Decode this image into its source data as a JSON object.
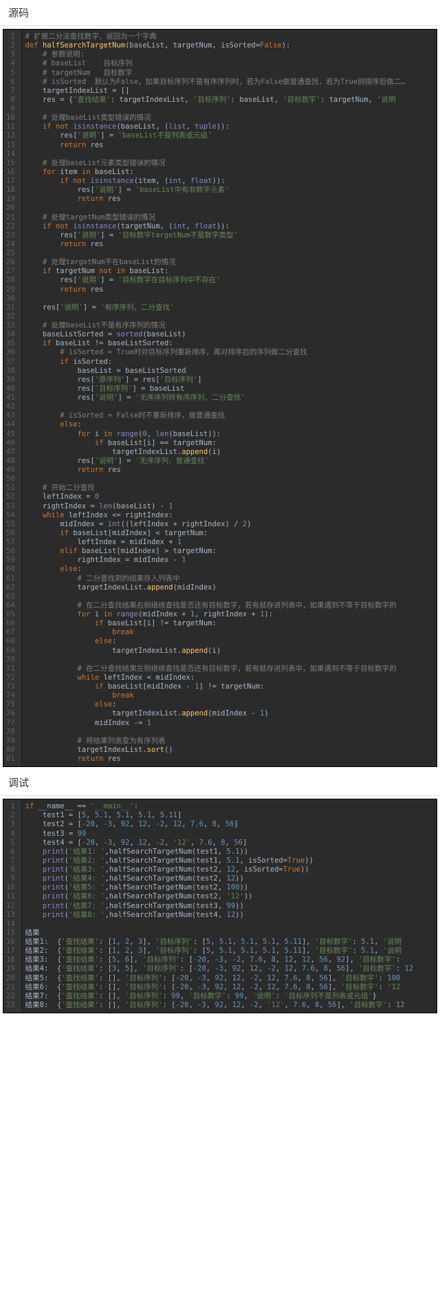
{
  "sections": {
    "source_title": "源码",
    "debug_title": "调试"
  },
  "source_lines": [
    "<span class='cm'># 扩展二分法查找数字，返回为一个字典</span>",
    "<span class='kw'>def </span><span class='fn'>halfSearchTargetNum</span>(baseList, targetNum, isSorted=<span class='kw'>False</span>):",
    "    <span class='cm'># 参数说明:</span>",
    "    <span class='cm'># baseList    目标序列</span>",
    "    <span class='cm'># targetNum   目标数字</span>",
    "    <span class='cm'># isSorted  默认为False，如果目标序列不是有序序列时，若为False做普通查找，若为True则排序后做二…</span>",
    "    targetIndexList = []",
    "    res = {<span class='st'>'查找结果'</span>: targetIndexList, <span class='st'>'目标序列'</span>: baseList, <span class='st'>'目标数字'</span>: targetNum, <span class='st'>'说明</span>",
    " ",
    "    <span class='cm'># 处理baseList类型错误的情况</span>",
    "    <span class='kw'>if not </span><span class='bi'>isinstance</span>(baseList, (<span class='bi'>list</span>, <span class='bi'>tuple</span>)):",
    "        res[<span class='st'>'说明'</span>] = <span class='st'>'baseList不是列表或元组'</span>",
    "        <span class='kw'>return </span>res",
    " ",
    "    <span class='cm'># 处理baseList元素类型错误的情况</span>",
    "    <span class='kw'>for </span>item <span class='kw'>in </span>baseList:",
    "        <span class='kw'>if not </span><span class='bi'>isinstance</span>(item, (<span class='bi'>int</span>, <span class='bi'>float</span>)):",
    "            res[<span class='st'>'说明'</span>] = <span class='st'>'baseList中有非数字元素'</span>",
    "            <span class='kw'>return </span>res",
    " ",
    "    <span class='cm'># 处理targetNum类型错误的情况</span>",
    "    <span class='kw'>if not </span><span class='bi'>isinstance</span>(targetNum, (<span class='bi'>int</span>, <span class='bi'>float</span>)):",
    "        res[<span class='st'>'说明'</span>] = <span class='st'>'目标数字targetNum不是数字类型'</span>",
    "        <span class='kw'>return </span>res",
    " ",
    "    <span class='cm'># 处理targetNum不在baseList的情况</span>",
    "    <span class='kw'>if </span>targetNum <span class='kw'>not in </span>baseList:",
    "        res[<span class='st'>'说明'</span>] = <span class='st'>'目标数字在目标序列中不存在'</span>",
    "        <span class='kw'>return </span>res",
    " ",
    "    res[<span class='st'>'说明'</span>] = <span class='st'>'有序序列，二分查找'</span>",
    " ",
    "    <span class='cm'># 处理baseList不是有序序列的情况</span>",
    "    baseListSorted = <span class='bi'>sorted</span>(baseList)",
    "    <span class='kw'>if </span>baseList != baseListSorted:",
    "        <span class='cm'># isSorted = True时对目标序列重新排序，再对排序后的序列做二分查找</span>",
    "        <span class='kw'>if </span>isSorted:",
    "            baseList = baseListSorted",
    "            res[<span class='st'>'原序列'</span>] = res[<span class='st'>'目标序列'</span>]",
    "            res[<span class='st'>'目标序列'</span>] = baseList",
    "            res[<span class='st'>'说明'</span>] = <span class='st'>'无序序列转有序序列，二分查找'</span>",
    " ",
    "        <span class='cm'># isSorted = False时不重新排序，做普通查找</span>",
    "        <span class='kw'>else</span>:",
    "            <span class='kw'>for </span>i <span class='kw'>in </span><span class='bi'>range</span>(<span class='nm'>0</span>, <span class='bi'>len</span>(baseList)):",
    "                <span class='kw'>if </span>baseList[i] == targetNum:",
    "                    targetIndexList.<span class='fn'>append</span>(i)",
    "            res[<span class='st'>'说明'</span>] = <span class='st'>'无序序列，普通查找'</span>",
    "            <span class='kw'>return </span>res",
    " ",
    "    <span class='cm'># 开始二分查找</span>",
    "    leftIndex = <span class='nm'>0</span>",
    "    rightIndex = <span class='bi'>len</span>(baseList) - <span class='nm'>1</span>",
    "    <span class='kw'>while </span>leftIndex &lt;= rightIndex:",
    "        midIndex = <span class='bi'>int</span>((leftIndex + rightIndex) / <span class='nm'>2</span>)",
    "        <span class='kw'>if </span>baseList[midIndex] &lt; targetNum:",
    "            leftIndex = midIndex + <span class='nm'>1</span>",
    "        <span class='kw'>elif </span>baseList[midIndex] &gt; targetNum:",
    "            rightIndex = midIndex - <span class='nm'>1</span>",
    "        <span class='kw'>else</span>:",
    "            <span class='cm'># 二分查找到的结果存入列表中</span>",
    "            targetIndexList.<span class='fn'>append</span>(midIndex)",
    " ",
    "            <span class='cm'># 在二分查找结果右侧继续查找是否还有目标数字，若有就存进列表中，如果遇到不等于目标数字的</span>",
    "            <span class='kw'>for </span>i <span class='kw'>in </span><span class='bi'>range</span>(midIndex + <span class='nm'>1</span>, rightIndex + <span class='nm'>1</span>):",
    "                <span class='kw'>if </span>baseList[i] != targetNum:",
    "                    <span class='kw'>break</span>",
    "                <span class='kw'>else</span>:",
    "                    targetIndexList.<span class='fn'>append</span>(i)",
    " ",
    "            <span class='cm'># 在二分查找结果左侧继续查找是否还有目标数字，若有就存进列表中，如果遇到不等于目标数字的</span>",
    "            <span class='kw'>while </span>leftIndex &lt; midIndex:",
    "                <span class='kw'>if </span>baseList[midIndex - <span class='nm'>1</span>] != targetNum:",
    "                    <span class='kw'>break</span>",
    "                <span class='kw'>else</span>:",
    "                    targetIndexList.<span class='fn'>append</span>(midIndex - <span class='nm'>1</span>)",
    "                midIndex -= <span class='nm'>1</span>",
    " ",
    "            <span class='cm'># 将结果列表变为有序列表</span>",
    "            targetIndexList.<span class='fn'>sort</span>()",
    "            <span class='kw'>return </span>res"
  ],
  "debug_lines": [
    "<span class='kw'>if </span>__name__ == <span class='st'>'__main__'</span>:",
    "    test1 = [<span class='nm'>5</span>, <span class='nm'>5.1</span>, <span class='nm'>5.1</span>, <span class='nm'>5.1</span>, <span class='nm'>5.11</span>]",
    "    test2 = [<span class='nm'>-20</span>, <span class='nm'>-3</span>, <span class='nm'>92</span>, <span class='nm'>12</span>, <span class='nm'>-2</span>, <span class='nm'>12</span>, <span class='nm'>7.6</span>, <span class='nm'>8</span>, <span class='nm'>56</span>]",
    "    test3 = <span class='nm'>99</span>",
    "    test4 = [<span class='nm'>-20</span>, <span class='nm'>-3</span>, <span class='nm'>92</span>, <span class='nm'>12</span>, <span class='nm'>-2</span>, <span class='st'>'12'</span>, <span class='nm'>7.6</span>, <span class='nm'>8</span>, <span class='nm'>56</span>]",
    "    <span class='bi'>print</span>(<span class='st'>'结果1: '</span>,halfSearchTargetNum(test1, <span class='nm'>5.1</span>))",
    "    <span class='bi'>print</span>(<span class='st'>'结果2: '</span>,halfSearchTargetNum(test1, <span class='nm'>5.1</span>, isSorted=<span class='kw'>True</span>))",
    "    <span class='bi'>print</span>(<span class='st'>'结果3: '</span>,halfSearchTargetNum(test2, <span class='nm'>12</span>, isSorted=<span class='kw'>True</span>))",
    "    <span class='bi'>print</span>(<span class='st'>'结果4: '</span>,halfSearchTargetNum(test2, <span class='nm'>12</span>))",
    "    <span class='bi'>print</span>(<span class='st'>'结果5: '</span>,halfSearchTargetNum(test2, <span class='nm'>100</span>))",
    "    <span class='bi'>print</span>(<span class='st'>'结果6: '</span>,halfSearchTargetNum(test2, <span class='st'>'12'</span>))",
    "    <span class='bi'>print</span>(<span class='st'>'结果7: '</span>,halfSearchTargetNum(test3, <span class='nm'>99</span>))",
    "    <span class='bi'>print</span>(<span class='st'>'结果8: '</span>,halfSearchTargetNum(test4, <span class='nm'>12</span>))",
    " "
  ],
  "results_heading": "结果",
  "results_lines": [
    "结果1:  {<span class='st'>'查找结果'</span>: [<span class='bl'>1</span>, <span class='bl'>2</span>, <span class='bl'>3</span>], <span class='st'>'目标序列'</span>: [<span class='bl'>5</span>, <span class='bl'>5.1</span>, <span class='bl'>5.1</span>, <span class='bl'>5.1</span>, <span class='bl'>5.11</span>], <span class='st'>'目标数字'</span>: <span class='bl'>5.1</span>, <span class='st'>'说明</span>",
    "结果2:  {<span class='st'>'查找结果'</span>: [<span class='bl'>1</span>, <span class='bl'>2</span>, <span class='bl'>3</span>], <span class='st'>'目标序列'</span>: [<span class='bl'>5</span>, <span class='bl'>5.1</span>, <span class='bl'>5.1</span>, <span class='bl'>5.1</span>, <span class='bl'>5.11</span>], <span class='st'>'目标数字'</span>: <span class='bl'>5.1</span>, <span class='st'>'说明</span>",
    "结果3:  {<span class='st'>'查找结果'</span>: [<span class='bl'>5</span>, <span class='bl'>6</span>], <span class='st'>'目标序列'</span>: [<span class='bl'>-20</span>, <span class='bl'>-3</span>, <span class='bl'>-2</span>, <span class='bl'>7.6</span>, <span class='bl'>8</span>, <span class='bl'>12</span>, <span class='bl'>12</span>, <span class='bl'>56</span>, <span class='bl'>92</span>], <span class='st'>'目标数字'</span>:",
    "结果4:  {<span class='st'>'查找结果'</span>: [<span class='bl'>3</span>, <span class='bl'>5</span>], <span class='st'>'目标序列'</span>: [<span class='bl'>-20</span>, <span class='bl'>-3</span>, <span class='bl'>92</span>, <span class='bl'>12</span>, <span class='bl'>-2</span>, <span class='bl'>12</span>, <span class='bl'>7.6</span>, <span class='bl'>8</span>, <span class='bl'>56</span>], <span class='st'>'目标数字'</span>: <span class='bl'>12</span>",
    "结果5:  {<span class='st'>'查找结果'</span>: [], <span class='st'>'目标序列'</span>: [<span class='bl'>-20</span>, <span class='bl'>-3</span>, <span class='bl'>92</span>, <span class='bl'>12</span>, <span class='bl'>-2</span>, <span class='bl'>12</span>, <span class='bl'>7.6</span>, <span class='bl'>8</span>, <span class='bl'>56</span>], <span class='st'>'目标数字'</span>: <span class='bl'>100</span>",
    "结果6:  {<span class='st'>'查找结果'</span>: [], <span class='st'>'目标序列'</span>: [<span class='bl'>-20</span>, <span class='bl'>-3</span>, <span class='bl'>92</span>, <span class='bl'>12</span>, <span class='bl'>-2</span>, <span class='bl'>12</span>, <span class='bl'>7.6</span>, <span class='bl'>8</span>, <span class='bl'>56</span>], <span class='st'>'目标数字'</span>: <span class='st'>'12</span>",
    "结果7:  {<span class='st'>'查找结果'</span>: [], <span class='st'>'目标序列'</span>: <span class='bl'>99</span>, <span class='st'>'目标数字'</span>: <span class='bl'>99</span>, <span class='st'>'说明'</span>: <span class='st'>'目标序列不是列表或元组'</span>}",
    "结果8:  {<span class='st'>'查找结果'</span>: [], <span class='st'>'目标序列'</span>: [<span class='bl'>-20</span>, <span class='bl'>-3</span>, <span class='bl'>92</span>, <span class='bl'>12</span>, <span class='bl'>-2</span>, <span class='st'>'12'</span>, <span class='bl'>7.6</span>, <span class='bl'>8</span>, <span class='bl'>56</span>], <span class='st'>'目标数字'</span>: <span class='bl'>12</span>"
  ]
}
